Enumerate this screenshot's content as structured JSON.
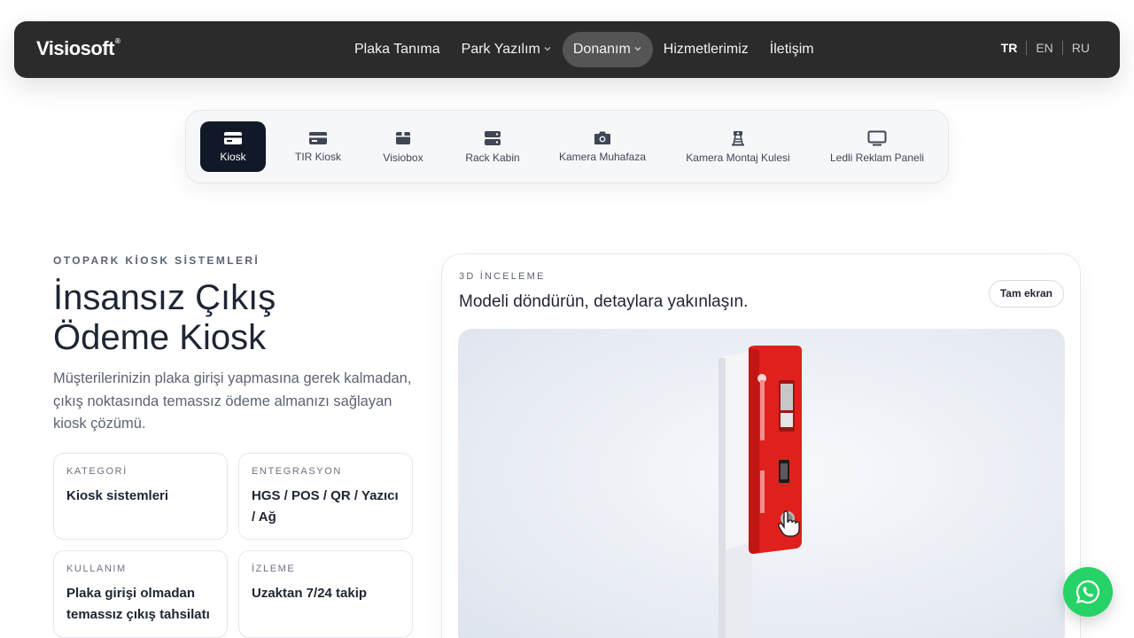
{
  "brand": {
    "name": "Visiosoft",
    "mark": "®"
  },
  "nav": {
    "items": [
      {
        "label": "Plaka Tanıma",
        "has_dropdown": false,
        "active": false
      },
      {
        "label": "Park Yazılım",
        "has_dropdown": true,
        "active": false
      },
      {
        "label": "Donanım",
        "has_dropdown": true,
        "active": true
      },
      {
        "label": "Hizmetlerimiz",
        "has_dropdown": false,
        "active": false
      },
      {
        "label": "İletişim",
        "has_dropdown": false,
        "active": false
      }
    ],
    "chevron_icon": "chevron-down-icon"
  },
  "languages": [
    {
      "code": "TR",
      "active": true
    },
    {
      "code": "EN",
      "active": false
    },
    {
      "code": "RU",
      "active": false
    }
  ],
  "subtabs": [
    {
      "label": "Kiosk",
      "icon": "card-icon",
      "active": true
    },
    {
      "label": "TIR Kiosk",
      "icon": "card-icon",
      "active": false
    },
    {
      "label": "Visiobox",
      "icon": "box-icon",
      "active": false
    },
    {
      "label": "Rack Kabin",
      "icon": "server-icon",
      "active": false
    },
    {
      "label": "Kamera Muhafaza",
      "icon": "camera-icon",
      "active": false
    },
    {
      "label": "Kamera Montaj Kulesi",
      "icon": "tower-icon",
      "active": false
    },
    {
      "label": "Ledli Reklam Paneli",
      "icon": "monitor-icon",
      "active": false
    }
  ],
  "hero": {
    "eyebrow": "OTOPARK KİOSK SİSTEMLERİ",
    "title_line1": "İnsansız Çıkış",
    "title_line2": "Ödeme Kiosk",
    "description": "Müşterilerinizin plaka girişi yapmasına gerek kalmadan, çıkış noktasında temassız ödeme almanızı sağlayan kiosk çözümü."
  },
  "cards": [
    {
      "label": "KATEGORİ",
      "value": "Kiosk sistemleri"
    },
    {
      "label": "ENTEGRASYON",
      "value": "HGS / POS / QR / Yazıcı / Ağ"
    },
    {
      "label": "KULLANIM",
      "value": "Plaka girişi olmadan temassız çıkış tahsilatı"
    },
    {
      "label": "İZLEME",
      "value": "Uzaktan 7/24 takip"
    }
  ],
  "viewer": {
    "eyebrow": "3D İNCELEME",
    "title": "Modeli döndürün, detaylara yakınlaşın.",
    "fullscreen_label": "Tam ekran",
    "model_icon": "kiosk-3d-model",
    "cursor_icon": "hand-pointer-icon"
  },
  "whatsapp": {
    "icon": "whatsapp-icon",
    "color": "#25d366"
  },
  "colors": {
    "topbar": "#2b2b2b",
    "active_tab": "#111827",
    "kiosk_red": "#e0201c",
    "text_dark": "#1e2533",
    "text_muted": "#5b6372"
  }
}
